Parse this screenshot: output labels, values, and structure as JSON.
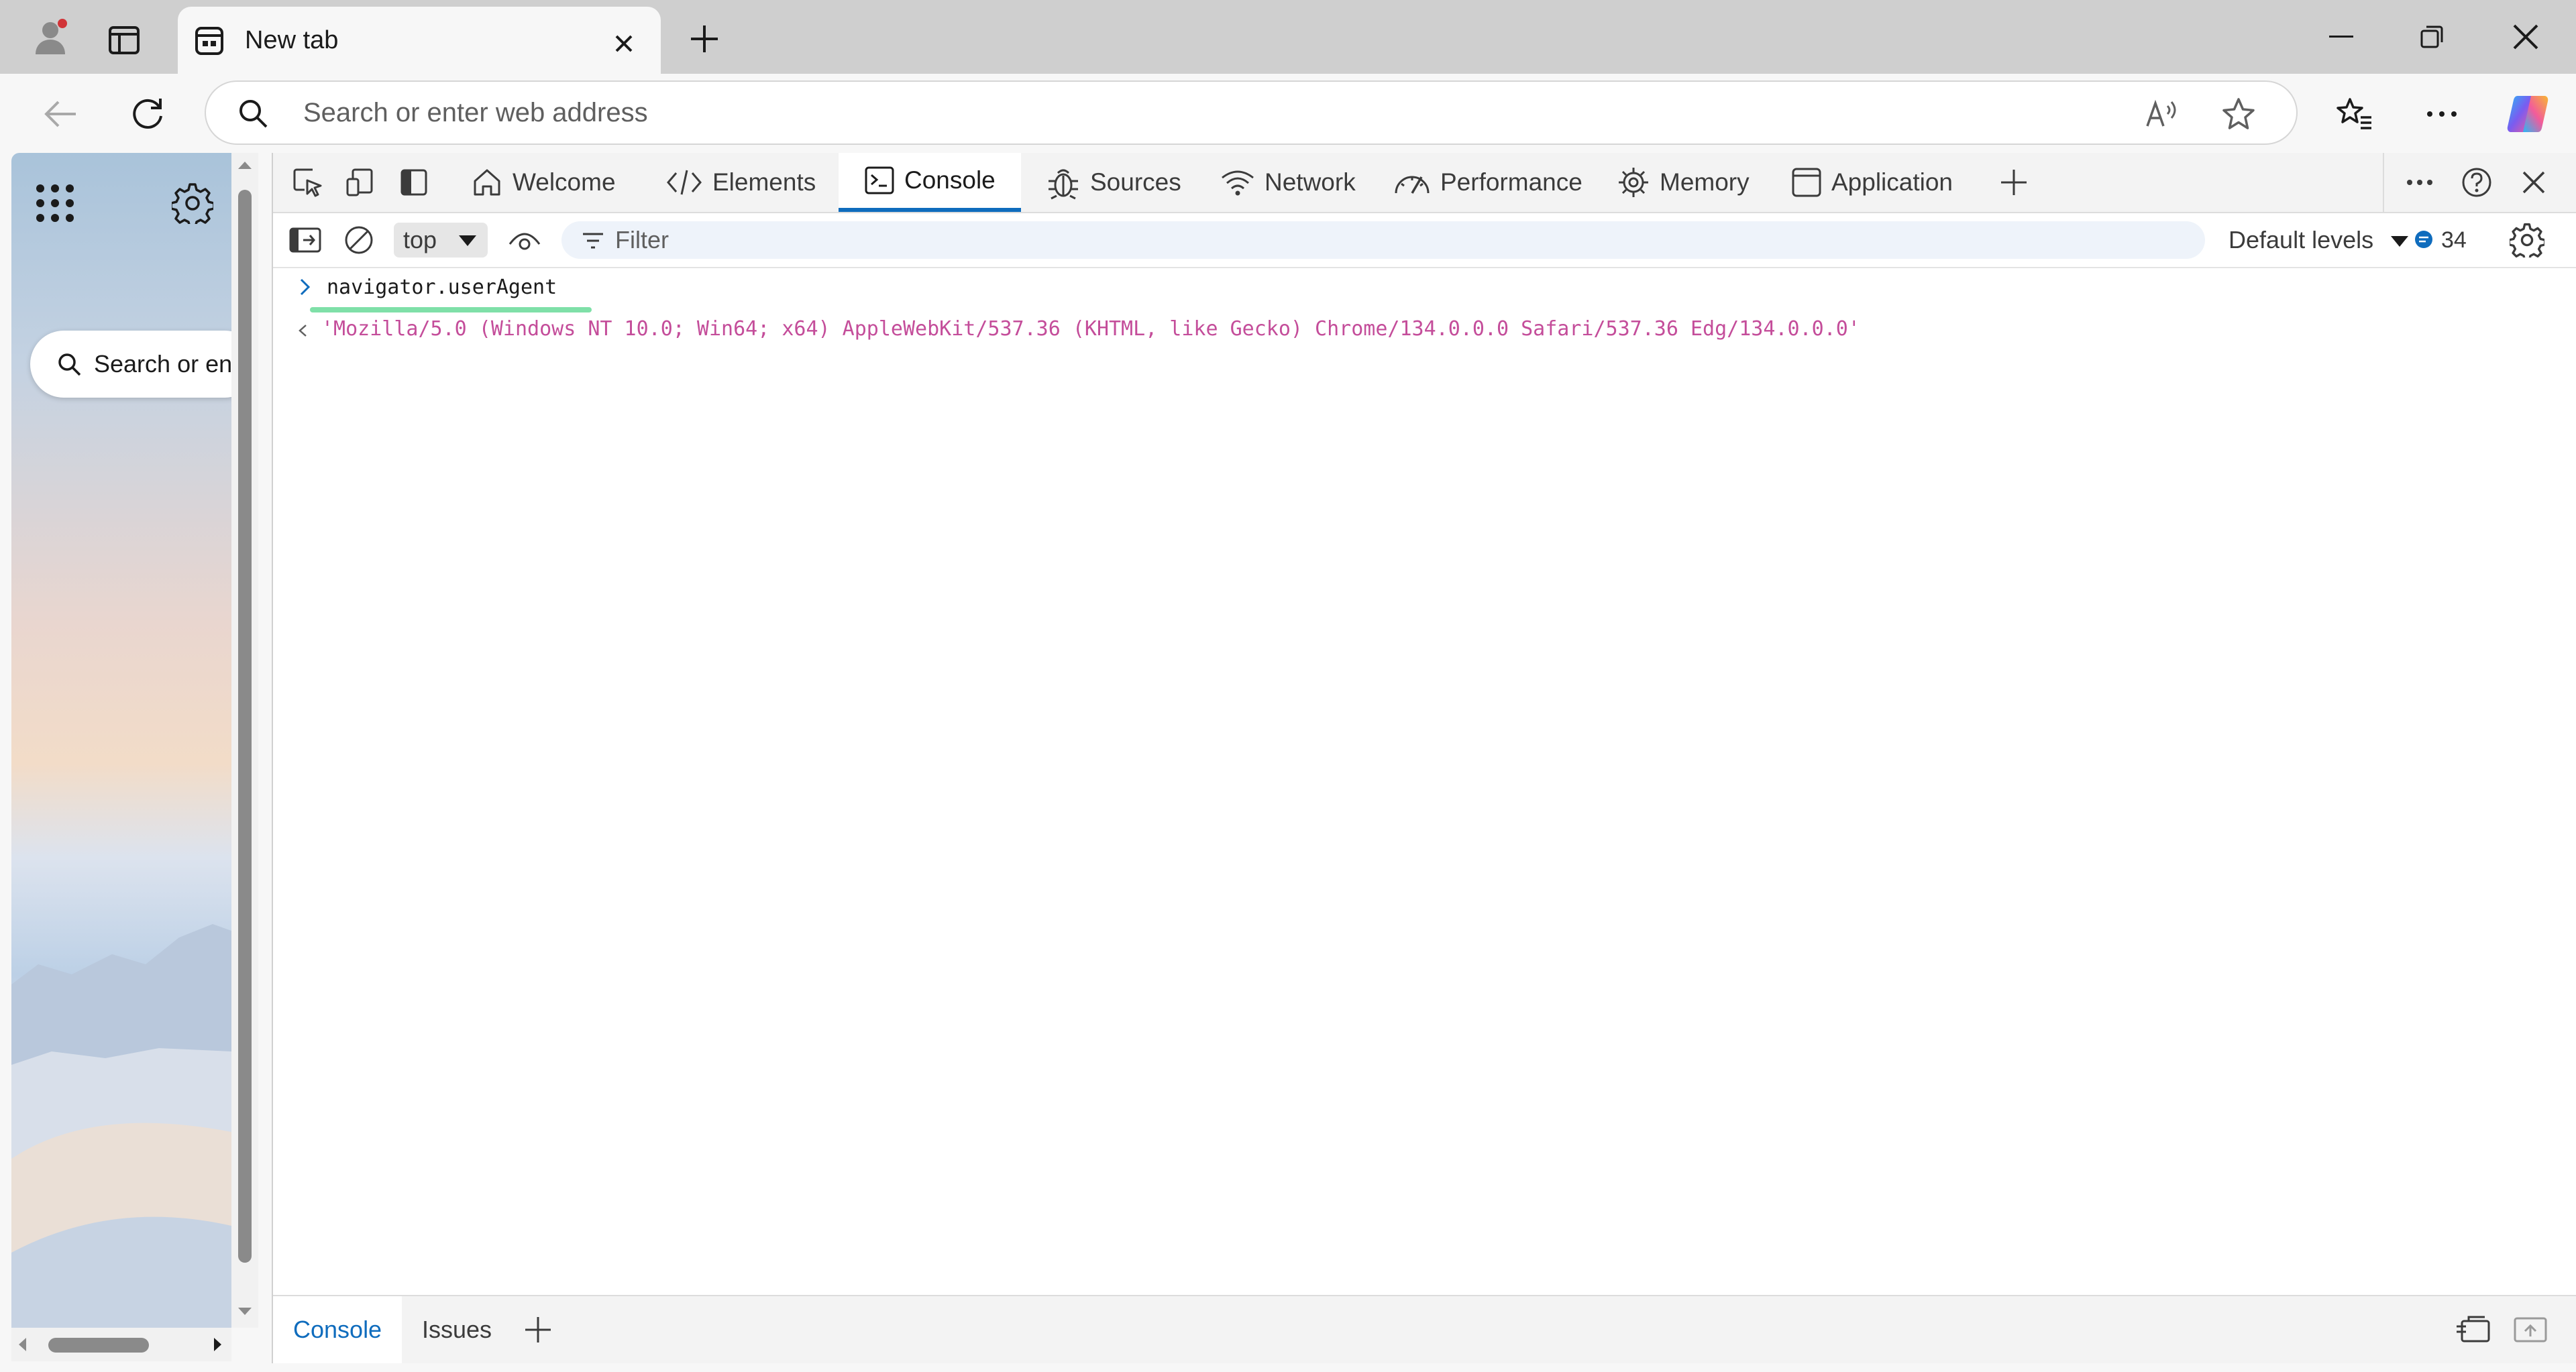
{
  "browser": {
    "tab_title": "New tab",
    "address_placeholder": "Search or enter web address"
  },
  "page": {
    "search_placeholder": "Search or ent"
  },
  "devtools": {
    "tabs": [
      {
        "label": "Welcome"
      },
      {
        "label": "Elements"
      },
      {
        "label": "Console"
      },
      {
        "label": "Sources"
      },
      {
        "label": "Network"
      },
      {
        "label": "Performance"
      },
      {
        "label": "Memory"
      },
      {
        "label": "Application"
      }
    ],
    "active_tab": "Console",
    "context": "top",
    "filter_placeholder": "Filter",
    "levels": "Default levels",
    "message_count": "34",
    "console": {
      "command": "navigator.userAgent",
      "result": "'Mozilla/5.0 (Windows NT 10.0; Win64; x64) AppleWebKit/537.36 (KHTML, like Gecko) Chrome/134.0.0.0 Safari/537.36 Edg/134.0.0.0'"
    },
    "drawer_tabs": [
      {
        "label": "Console"
      },
      {
        "label": "Issues"
      }
    ]
  },
  "colors": {
    "accent": "#0f6cbd",
    "result_text": "#c44d9a",
    "highlight_underline": "#7fe0a8"
  }
}
